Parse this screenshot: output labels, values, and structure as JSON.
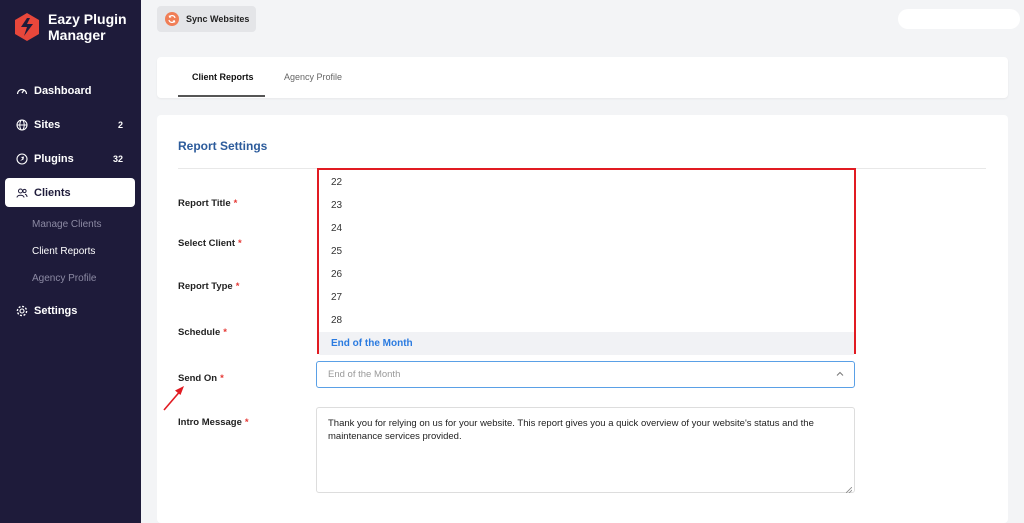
{
  "app": {
    "logo_line1": "Eazy Plugin",
    "logo_line2": "Manager"
  },
  "sidebar": {
    "items": [
      {
        "label": "Dashboard",
        "icon": "gauge-icon",
        "count": ""
      },
      {
        "label": "Sites",
        "icon": "globe-icon",
        "count": "2"
      },
      {
        "label": "Plugins",
        "icon": "plug-icon",
        "count": "32"
      },
      {
        "label": "Clients",
        "icon": "users-icon",
        "count": ""
      },
      {
        "label": "Settings",
        "icon": "gear-icon",
        "count": ""
      }
    ],
    "sub_items": [
      {
        "label": "Manage Clients"
      },
      {
        "label": "Client Reports"
      },
      {
        "label": "Agency Profile"
      }
    ]
  },
  "toolbar": {
    "sync_label": "Sync Websites"
  },
  "tabs": [
    {
      "label": "Client Reports"
    },
    {
      "label": "Agency Profile"
    }
  ],
  "form": {
    "title": "Report Settings",
    "required_mark": "*",
    "labels": {
      "report_title": "Report Title",
      "select_client": "Select Client",
      "report_type": "Report Type",
      "schedule": "Schedule",
      "send_on": "Send On",
      "intro_message": "Intro Message"
    },
    "send_on_value": "End of the Month",
    "intro_message_value": "Thank you for relying on us for your website. This report gives you a quick overview of your website's status and the maintenance services provided."
  },
  "dropdown": {
    "options": [
      "22",
      "23",
      "24",
      "25",
      "26",
      "27",
      "28",
      "End of the Month"
    ],
    "selected": "End of the Month"
  },
  "colors": {
    "sidebar_bg": "#1e1b3a",
    "accent_blue": "#2c5b9b",
    "highlight_red": "#e11b22",
    "sync_orange": "#f07e56"
  }
}
